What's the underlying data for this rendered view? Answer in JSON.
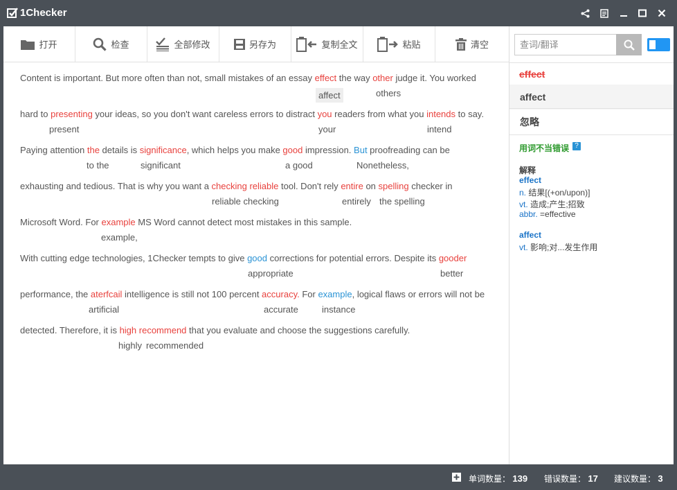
{
  "app": {
    "title": "1Checker"
  },
  "toolbar": [
    {
      "label": "打开",
      "icon": "folder-icon"
    },
    {
      "label": "检查",
      "icon": "magnifier-icon"
    },
    {
      "label": "全部修改",
      "icon": "checklist-icon"
    },
    {
      "label": "另存为",
      "icon": "save-icon"
    },
    {
      "label": "复制全文",
      "icon": "copy-icon"
    },
    {
      "label": "粘贴",
      "icon": "paste-icon"
    },
    {
      "label": "清空",
      "icon": "trash-icon"
    }
  ],
  "editor": {
    "lines": [
      [
        "Content is important. But more often than not, small mistakes of an essay ",
        {
          "t": "effect",
          "c": "err"
        },
        " the way ",
        {
          "t": "other",
          "c": "err"
        },
        " judge it. You worked"
      ],
      [
        "hard to ",
        {
          "t": "presenting",
          "c": "err"
        },
        " your ideas, so you don't want careless errors to distract ",
        {
          "t": "you",
          "c": "err"
        },
        " readers from what you ",
        {
          "t": "intends",
          "c": "err"
        },
        " to say."
      ],
      [
        "Paying attention ",
        {
          "t": "the",
          "c": "err"
        },
        " details is ",
        {
          "t": "significance",
          "c": "err"
        },
        ", which helps you make ",
        {
          "t": "good",
          "c": "err"
        },
        " impression. ",
        {
          "t": "But",
          "c": "blu"
        },
        " proofreading can be"
      ],
      [
        "exhausting and tedious. That is why you want a ",
        {
          "t": "checking reliable",
          "c": "err"
        },
        " tool. Don't rely ",
        {
          "t": "entire",
          "c": "err"
        },
        " on ",
        {
          "t": "spelling",
          "c": "err"
        },
        " checker in"
      ],
      [
        "Microsoft Word. For ",
        {
          "t": "example",
          "c": "err"
        },
        " MS Word cannot detect most mistakes in this sample."
      ],
      [
        "With cutting edge technologies, 1Checker tempts to give ",
        {
          "t": "good",
          "c": "blu"
        },
        " corrections for potential errors. Despite its ",
        {
          "t": "gooder",
          "c": "err"
        }
      ],
      [
        "performance, the ",
        {
          "t": "aterfcail",
          "c": "err"
        },
        " intelligence is still not 100 percent ",
        {
          "t": "accuracy.",
          "c": "err"
        },
        " For ",
        {
          "t": "example",
          "c": "blu"
        },
        ", logical flaws or errors will not be"
      ],
      [
        "detected. Therefore, it is ",
        {
          "t": "high",
          "c": "err"
        },
        "   ",
        {
          "t": "recommend",
          "c": "err"
        },
        " that you evaluate and choose the suggestions carefully."
      ]
    ],
    "suggestions": [
      [
        "affect",
        "others"
      ],
      [
        "present",
        "your",
        "intend"
      ],
      [
        "to the",
        "significant",
        "a good",
        "Nonetheless,"
      ],
      [
        "reliable checking",
        "entirely",
        "the spelling"
      ],
      [
        "example,"
      ],
      [
        "appropriate",
        "better"
      ],
      [
        "artificial",
        "accurate",
        "instance"
      ],
      [
        "highly",
        "recommended"
      ]
    ]
  },
  "sidebar": {
    "search_placeholder": "查词/翻译",
    "wrong_word": "effect",
    "suggestion": "affect",
    "ignore": "忽略",
    "category": "用词不当错误",
    "help": "?",
    "definitions_title": "解释",
    "definitions": [
      {
        "word": "effect",
        "lines": [
          {
            "pos": "n.",
            "text": "结果[(+on/upon)]"
          },
          {
            "pos": "vt.",
            "text": "造成;产生;招致"
          },
          {
            "pos": "abbr.",
            "text": "=effective"
          }
        ]
      },
      {
        "word": "affect",
        "lines": [
          {
            "pos": "vt.",
            "text": "影响;对...发生作用"
          }
        ]
      }
    ]
  },
  "status": {
    "word_count_label": "单词数量：",
    "word_count": "139",
    "error_count_label": "错误数量：",
    "error_count": "17",
    "suggest_count_label": "建议数量：",
    "suggest_count": "3"
  }
}
